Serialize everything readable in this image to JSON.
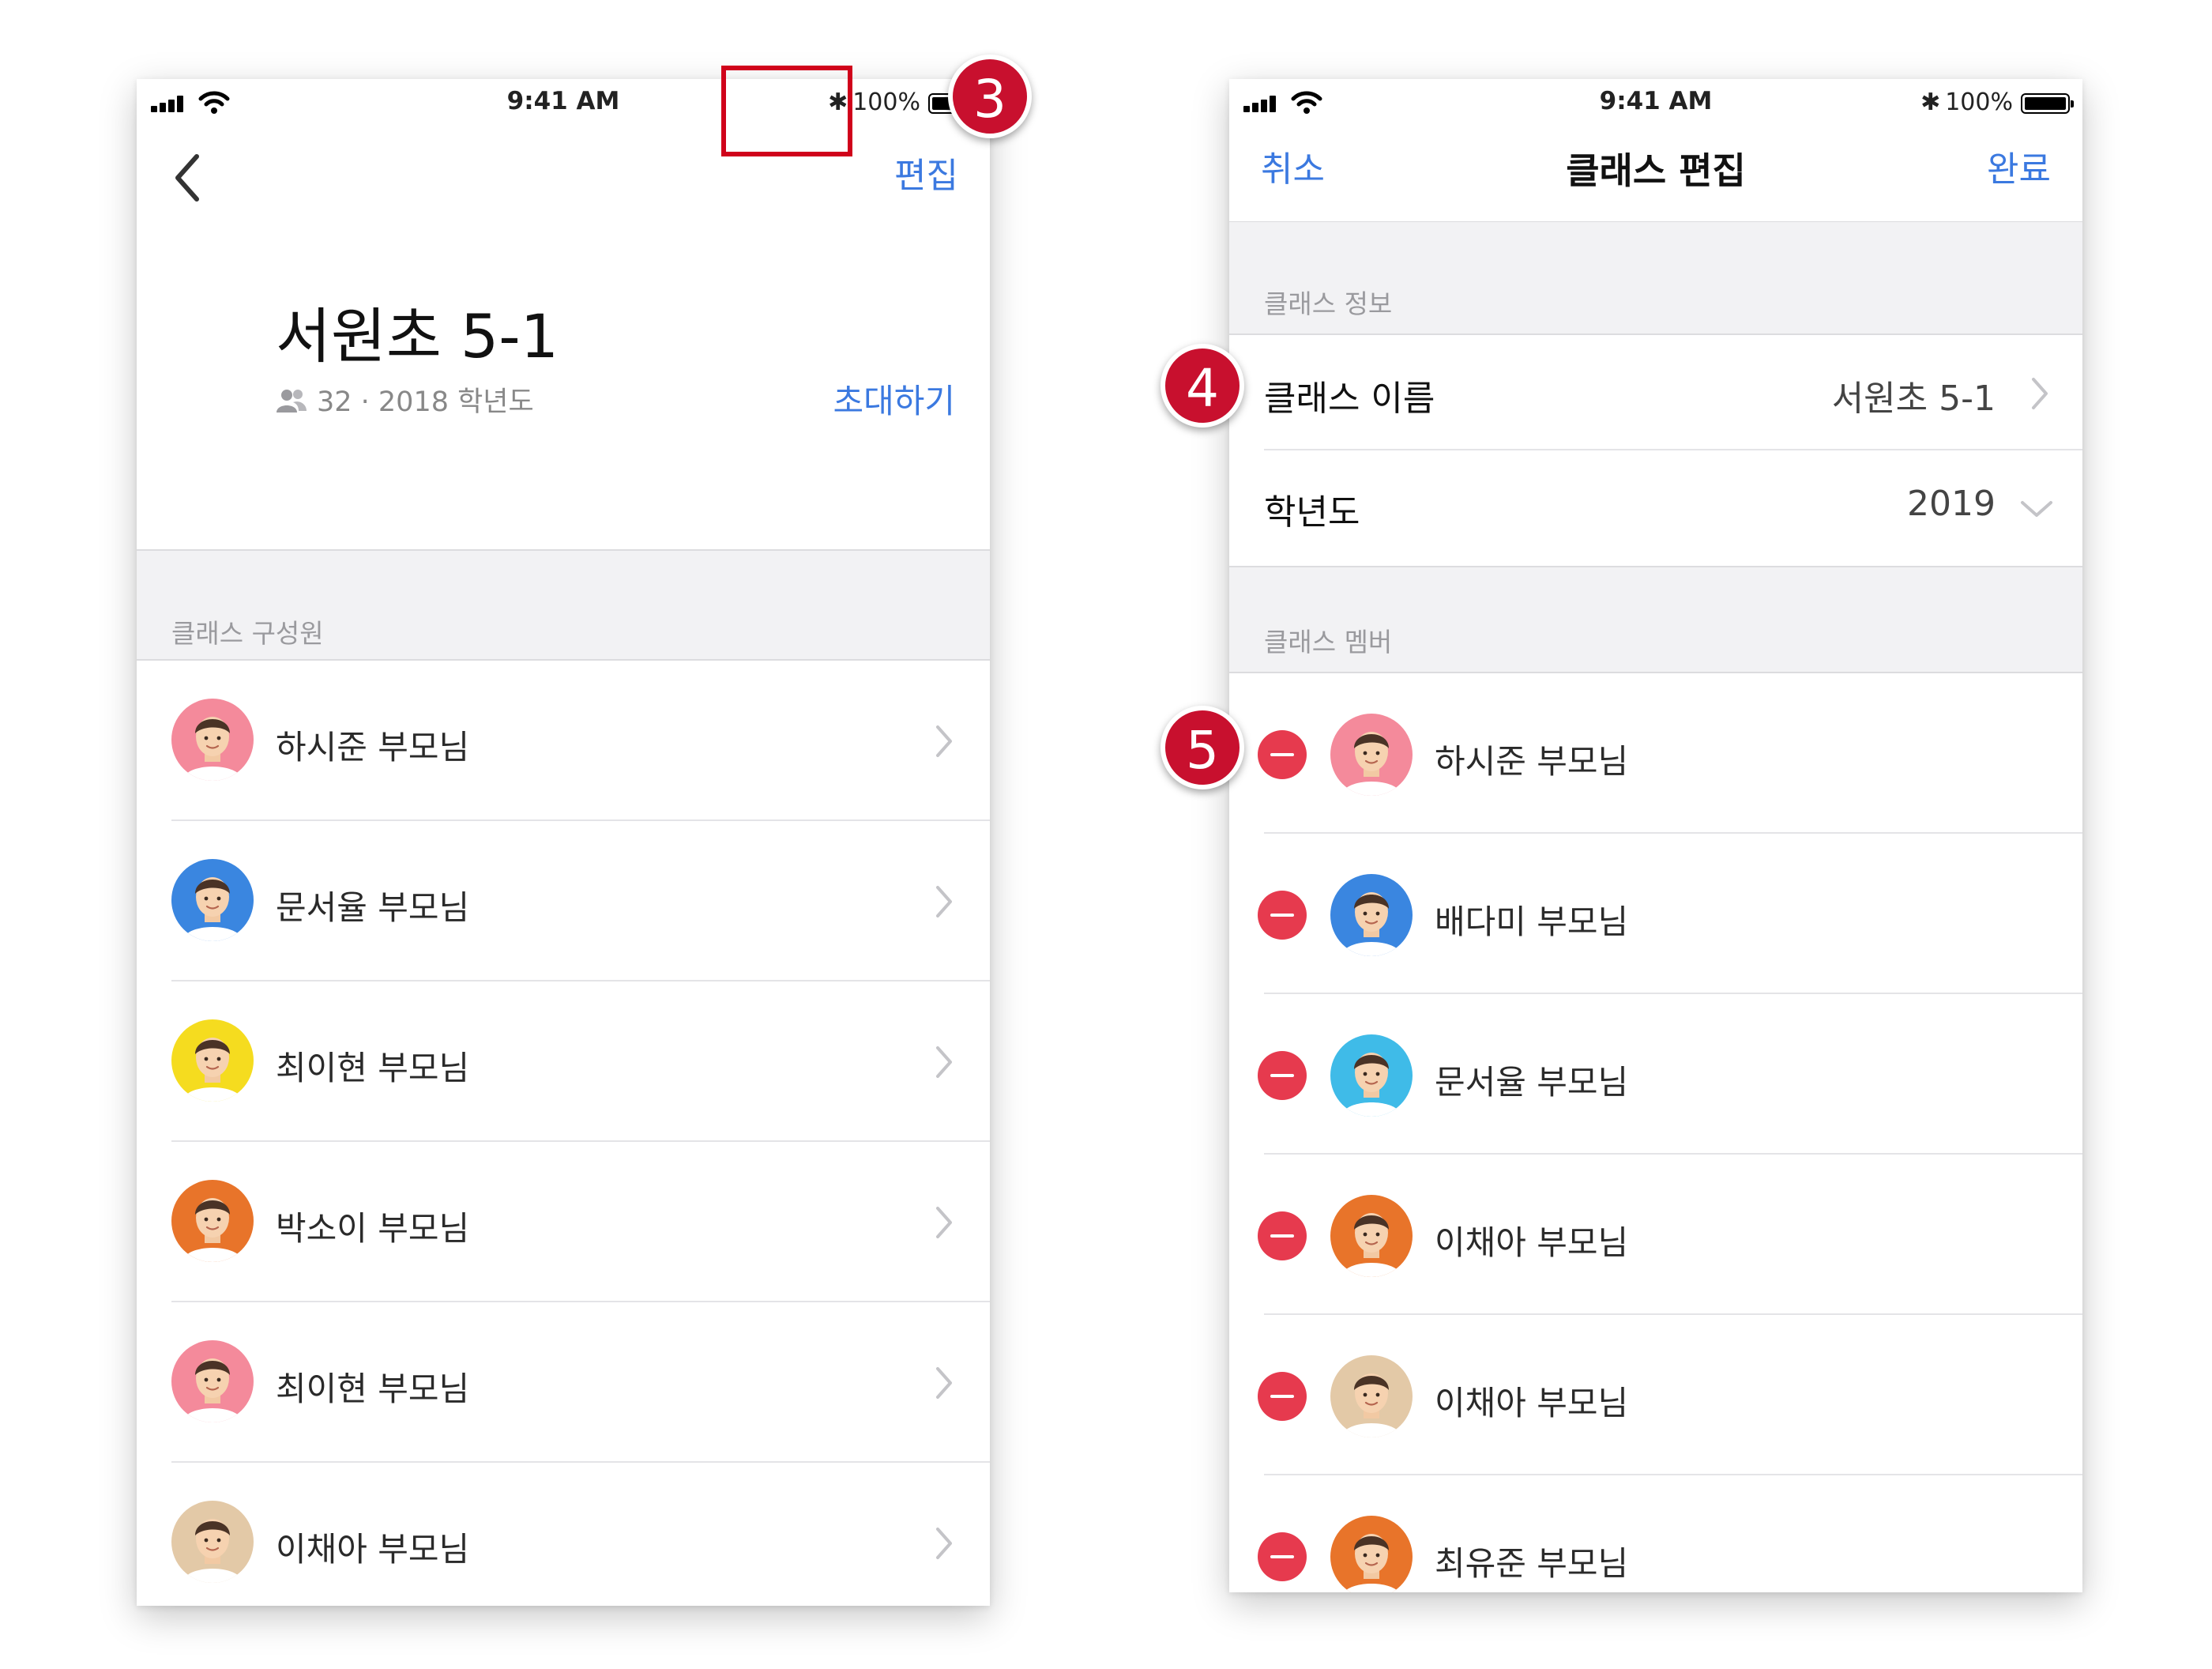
{
  "left_screen": {
    "status": {
      "time": "9:41 AM",
      "battery": "100%"
    },
    "nav": {
      "edit_label": "편집"
    },
    "class_name": "서원초 5-1",
    "meta": "32 · 2018 학년도",
    "invite_label": "초대하기",
    "section_label": "클래스 구성원",
    "members": [
      {
        "name": "하시준 부모님",
        "avatar_bg": "#f48a9b"
      },
      {
        "name": "문서율 부모님",
        "avatar_bg": "#3a86e0"
      },
      {
        "name": "최이현 부모님",
        "avatar_bg": "#f5dc1f"
      },
      {
        "name": "박소이 부모님",
        "avatar_bg": "#e8742a"
      },
      {
        "name": "최이현 부모님",
        "avatar_bg": "#f48a9b"
      },
      {
        "name": "이채아 부모님",
        "avatar_bg": "#e3c9a7"
      }
    ]
  },
  "right_screen": {
    "status": {
      "time": "9:41 AM",
      "battery": "100%"
    },
    "nav": {
      "cancel_label": "취소",
      "title": "클래스 편집",
      "done_label": "완료"
    },
    "info_section_label": "클래스 정보",
    "class_name_label": "클래스 이름",
    "class_name_value": "서원초 5-1",
    "year_label": "학년도",
    "year_value": "2019",
    "members_section_label": "클래스 멤버",
    "members": [
      {
        "name": "하시준 부모님",
        "avatar_bg": "#f48a9b"
      },
      {
        "name": "배다미 부모님",
        "avatar_bg": "#3a86e0"
      },
      {
        "name": "문서율 부모님",
        "avatar_bg": "#3fbbe8"
      },
      {
        "name": "이채아 부모님",
        "avatar_bg": "#e8742a"
      },
      {
        "name": "이채아 부모님",
        "avatar_bg": "#e3c9a7"
      },
      {
        "name": "최유준 부모님",
        "avatar_bg": "#e8742a"
      }
    ]
  },
  "steps": {
    "step3": "3",
    "step4": "4",
    "step5": "5"
  },
  "colors": {
    "accent": "#3b79e0",
    "badge": "#c8102e",
    "remove": "#e63a4e",
    "section_bg": "#f2f2f4"
  }
}
